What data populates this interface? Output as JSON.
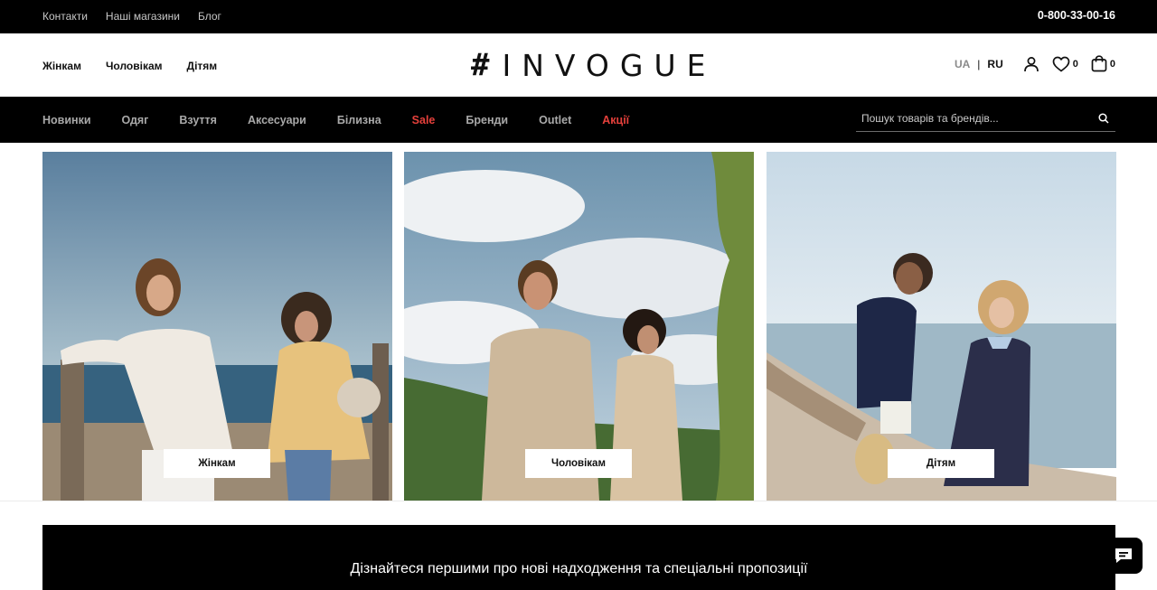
{
  "topbar": {
    "links": [
      "Контакти",
      "Наші магазини",
      "Блог"
    ],
    "phone": "0-800-33-00-16"
  },
  "header": {
    "gender_links": [
      "Жінкам",
      "Чоловікам",
      "Дітям"
    ],
    "logo_hash": "#",
    "logo_word": "INVOGUE",
    "lang_ua": "UA",
    "lang_sep": "|",
    "lang_ru": "RU",
    "wishlist_count": "0",
    "cart_count": "0",
    "icons": [
      "user-icon",
      "heart-icon",
      "bag-icon"
    ]
  },
  "nav": {
    "items": [
      {
        "label": "Новинки",
        "highlight": false
      },
      {
        "label": "Одяг",
        "highlight": false
      },
      {
        "label": "Взуття",
        "highlight": false
      },
      {
        "label": "Аксесуари",
        "highlight": false
      },
      {
        "label": "Білизна",
        "highlight": false
      },
      {
        "label": "Sale",
        "highlight": true
      },
      {
        "label": "Бренди",
        "highlight": false
      },
      {
        "label": "Outlet",
        "highlight": false
      },
      {
        "label": "Акції",
        "highlight": true
      }
    ],
    "search_placeholder": "Пошук товарів та брендів..."
  },
  "categories": [
    {
      "label": "Жінкам"
    },
    {
      "label": "Чоловікам"
    },
    {
      "label": "Дітям"
    }
  ],
  "newsletter": {
    "text": "Дізнайтеся першими про нові надходження та спеціальні пропозиції"
  },
  "colors": {
    "bar_bg": "#000000",
    "accent_red": "#e5403b",
    "nav_text": "#a9a9a9"
  }
}
